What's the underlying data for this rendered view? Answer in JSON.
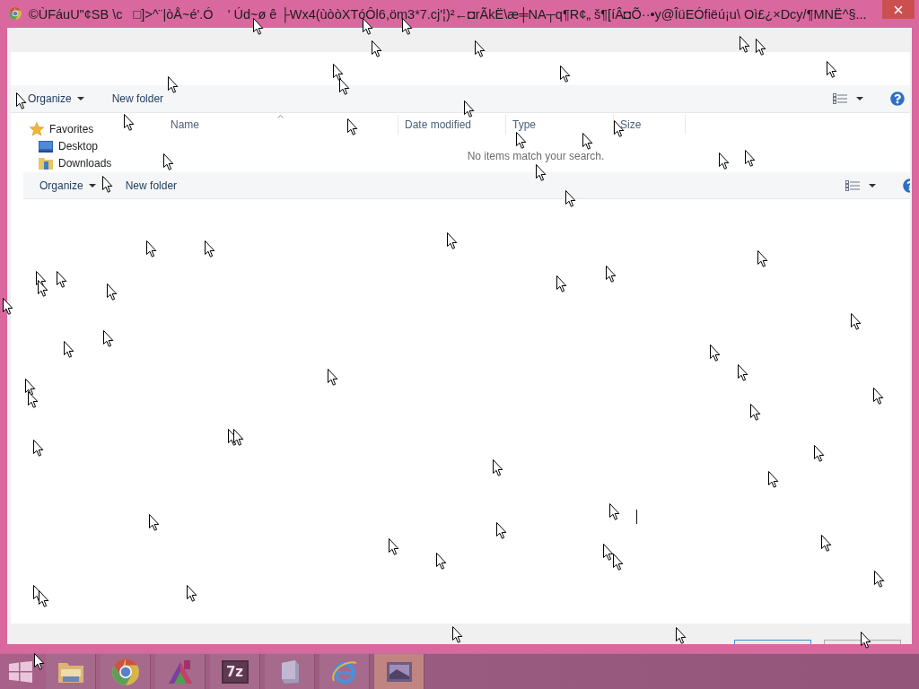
{
  "window": {
    "title": "©ÙFáuU\"¢SB \\c   □]>^¨|òÅ~é'.Ó    ' Úd~ø ê ├Wx4(ùòòXTóÔl6,öm3*7.cj'¦)²←◘rÃkË\\æ╪NA┬q¶R¢„ š¶[íÂ◘Õ··•y@ÎüEÓfiëú¡u\\ Oì£¿×Dcy/¶MNË^§..."
  },
  "dialog": {
    "toolbar": {
      "organize": "Organize",
      "new_folder": "New folder"
    },
    "navigation": [
      {
        "kind": "favorites",
        "label": "Favorites"
      },
      {
        "kind": "desktop",
        "label": "Desktop"
      },
      {
        "kind": "downloads",
        "label": "Downloads"
      }
    ],
    "columns": [
      {
        "label": "Name",
        "sorted": true
      },
      {
        "label": "Date modified",
        "sorted": false
      },
      {
        "label": "Type",
        "sorted": false
      },
      {
        "label": "Size",
        "sorted": false
      }
    ],
    "empty_message": "No items match your search.",
    "footer_buttons": [
      {
        "default": true
      },
      {
        "default": false
      }
    ]
  },
  "overlay_toolbar": {
    "organize": "Organize",
    "new_folder": "New folder"
  },
  "taskbar": {
    "items": [
      {
        "kind": "start",
        "selected": false
      },
      {
        "kind": "file-explorer",
        "selected": false
      },
      {
        "kind": "chrome",
        "selected": false
      },
      {
        "kind": "paint",
        "selected": false
      },
      {
        "kind": "archiver",
        "text": "7z",
        "selected": false
      },
      {
        "kind": "app",
        "selected": false
      },
      {
        "kind": "ie",
        "selected": false
      },
      {
        "kind": "viewer",
        "selected": true
      }
    ]
  }
}
